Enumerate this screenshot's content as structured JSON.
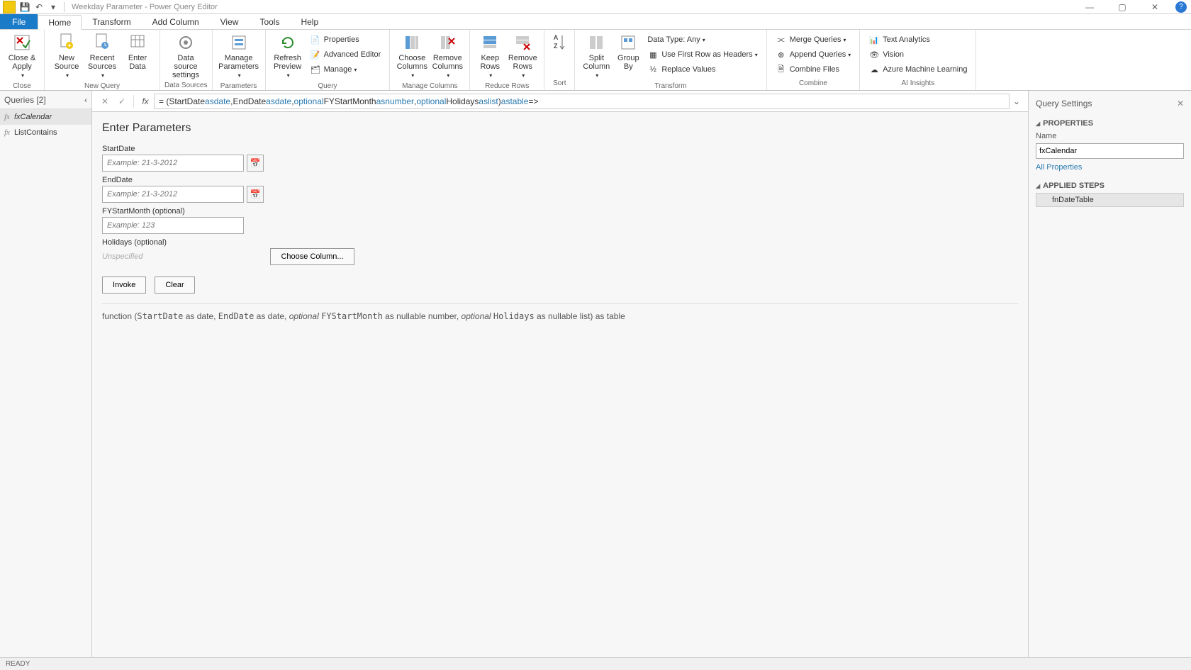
{
  "title": "Weekday Parameter - Power Query Editor",
  "tabs": {
    "file": "File",
    "home": "Home",
    "transform": "Transform",
    "addcol": "Add Column",
    "view": "View",
    "tools": "Tools",
    "help": "Help"
  },
  "ribbon": {
    "close_apply": "Close &\nApply",
    "new_source": "New\nSource",
    "recent_sources": "Recent\nSources",
    "enter_data": "Enter\nData",
    "ds_settings": "Data source\nsettings",
    "manage_params": "Manage\nParameters",
    "refresh": "Refresh\nPreview",
    "properties": "Properties",
    "adv_editor": "Advanced Editor",
    "manage": "Manage",
    "choose_cols": "Choose\nColumns",
    "remove_cols": "Remove\nColumns",
    "keep_rows": "Keep\nRows",
    "remove_rows": "Remove\nRows",
    "sort": "Sort",
    "split_col": "Split\nColumn",
    "group_by": "Group\nBy",
    "data_type": "Data Type: Any",
    "first_row": "Use First Row as Headers",
    "replace": "Replace Values",
    "merge": "Merge Queries",
    "append": "Append Queries",
    "combine_files": "Combine Files",
    "text_an": "Text Analytics",
    "vision": "Vision",
    "azure": "Azure Machine Learning",
    "g_close": "Close",
    "g_newq": "New Query",
    "g_ds": "Data Sources",
    "g_params": "Parameters",
    "g_query": "Query",
    "g_mcols": "Manage Columns",
    "g_rrows": "Reduce Rows",
    "g_sort": "Sort",
    "g_transform": "Transform",
    "g_combine": "Combine",
    "g_ai": "AI Insights"
  },
  "queries": {
    "header": "Queries [2]",
    "items": [
      "fxCalendar",
      "ListContains"
    ]
  },
  "formula": {
    "prefix": "= (",
    "p1": "StartDate ",
    "as": "as ",
    "t_date": "date",
    "c1": ", ",
    "p2": "EndDate ",
    "c2": ", ",
    "opt": "optional ",
    "p3": "FYStartMonth ",
    "t_num": "number",
    "c3": ", ",
    "p4": "Holidays ",
    "t_list": "list",
    "close": ") ",
    "t_table": "table",
    "arrow": " =>"
  },
  "form": {
    "title": "Enter Parameters",
    "start_lbl": "StartDate",
    "end_lbl": "EndDate",
    "fy_lbl": "FYStartMonth (optional)",
    "hol_lbl": "Holidays (optional)",
    "date_ph": "Example: 21-3-2012",
    "num_ph": "Example: 123",
    "unspec": "Unspecified",
    "choose": "Choose Column...",
    "invoke": "Invoke",
    "clear": "Clear"
  },
  "signature": {
    "a": "function (",
    "b": "StartDate",
    "c": " as date, ",
    "d": "EndDate",
    "e": " as date, ",
    "f": "optional ",
    "g": "FYStartMonth",
    "h": " as nullable number, ",
    "i": "optional ",
    "j": "Holidays",
    "k": " as nullable list) as table"
  },
  "settings": {
    "title": "Query Settings",
    "props": "PROPERTIES",
    "name_lbl": "Name",
    "name_val": "fxCalendar",
    "all_props": "All Properties",
    "applied": "APPLIED STEPS",
    "step1": "fnDateTable"
  },
  "status": "READY"
}
